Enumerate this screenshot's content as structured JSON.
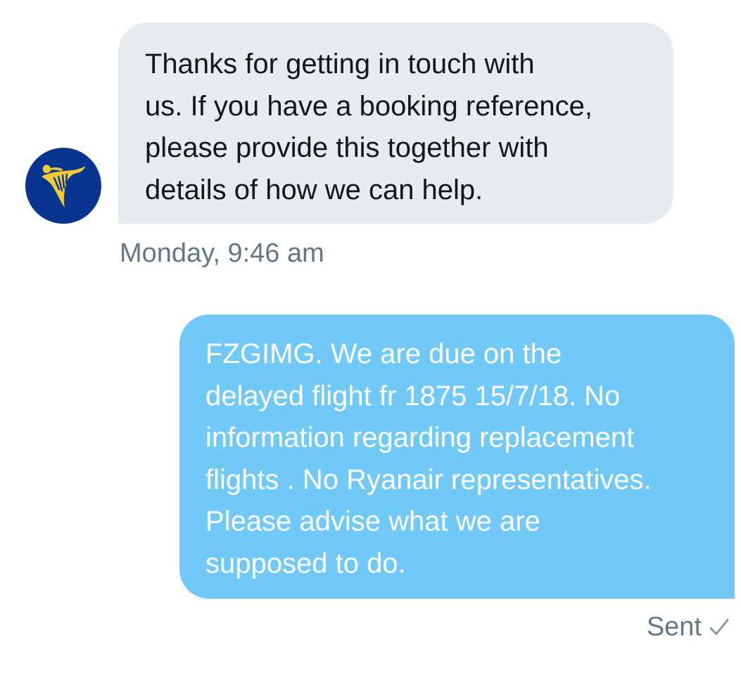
{
  "conversation": {
    "incoming": {
      "avatar_icon": "ryanair-harp-logo-icon",
      "avatar_bg": "#073590",
      "avatar_fg": "#f1c933",
      "text": "Thanks for getting in touch with\nus. If you have a booking reference,\nplease provide this together with\ndetails of how we can help.",
      "timestamp": "Monday, 9:46 am"
    },
    "outgoing": {
      "text": "FZGIMG.  We are due on the\ndelayed flight fr 1875 15/7/18.  No\ninformation regarding replacement\nflights . No Ryanair representatives.\nPlease advise what we are\nsupposed to do.",
      "status": "Sent",
      "status_icon": "check-icon"
    }
  },
  "colors": {
    "incoming_bubble": "#e6ecf0",
    "outgoing_bubble": "#71c9f8",
    "meta_text": "#657786"
  }
}
